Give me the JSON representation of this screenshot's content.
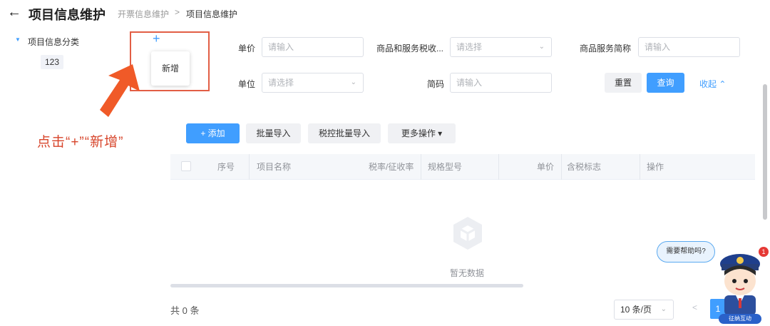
{
  "header": {
    "back_icon": "arrow-left-icon",
    "title": "项目信息维护",
    "breadcrumb": [
      "开票信息维护",
      "项目信息维护"
    ],
    "breadcrumb_separator": ">"
  },
  "tree": {
    "root_label": "项目信息分类",
    "child_label": "123",
    "add_symbol": "+",
    "popup_item": "新增"
  },
  "annotation": {
    "instruction": "点击“+”“新增”",
    "highlight_color": "#e25e45",
    "arrow_color": "#f05a28"
  },
  "filters": {
    "unit_price_label": "单价",
    "unit_price_placeholder": "请输入",
    "tax_category_label": "商品和服务税收...",
    "tax_category_placeholder": "请选择",
    "short_name_label": "商品服务简称",
    "short_name_placeholder": "请输入",
    "unit_label": "单位",
    "unit_placeholder": "请选择",
    "code_label": "简码",
    "code_placeholder": "请输入",
    "reset_label": "重置",
    "query_label": "查询",
    "collapse_label": "收起 ⌃"
  },
  "toolbar": {
    "add_label": "+ 添加",
    "batch_import_label": "批量导入",
    "tax_batch_import_label": "税控批量导入",
    "more_actions_label": "更多操作 ▾"
  },
  "table": {
    "columns": [
      "序号",
      "项目名称",
      "税率/征收率",
      "规格型号",
      "单价",
      "含税标志",
      "操作"
    ],
    "empty_text": "暂无数据"
  },
  "pagination": {
    "total_text": "共 0 条",
    "page_size": "10 条/页",
    "prev": "<",
    "current_page": "1"
  },
  "help": {
    "bubble_text": "需要帮助吗?",
    "badge_count": "1",
    "label": "征纳互动"
  },
  "colors": {
    "primary": "#409eff",
    "annotation": "#d7452b"
  }
}
